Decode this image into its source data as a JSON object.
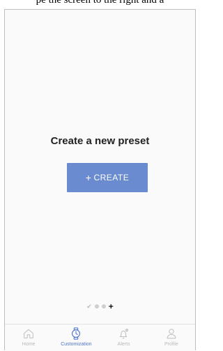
{
  "top_caption": "pe the screen to the right and a",
  "main": {
    "heading": "Create a new preset",
    "create_button": {
      "icon": "plus-icon",
      "label": "CREATE",
      "color": "#6b8bd0"
    }
  },
  "pager": {
    "pages": [
      "check",
      "dot",
      "dot",
      "add"
    ]
  },
  "tabs": [
    {
      "label": "Home",
      "icon": "home-icon",
      "active": false
    },
    {
      "label": "Customization",
      "icon": "watch-icon",
      "active": true
    },
    {
      "label": "Alerts",
      "icon": "bell-gear-icon",
      "active": false
    },
    {
      "label": "Profile",
      "icon": "person-icon",
      "active": false
    }
  ],
  "colors": {
    "accent": "#4f74c9",
    "inactive": "#b9b9b9"
  }
}
